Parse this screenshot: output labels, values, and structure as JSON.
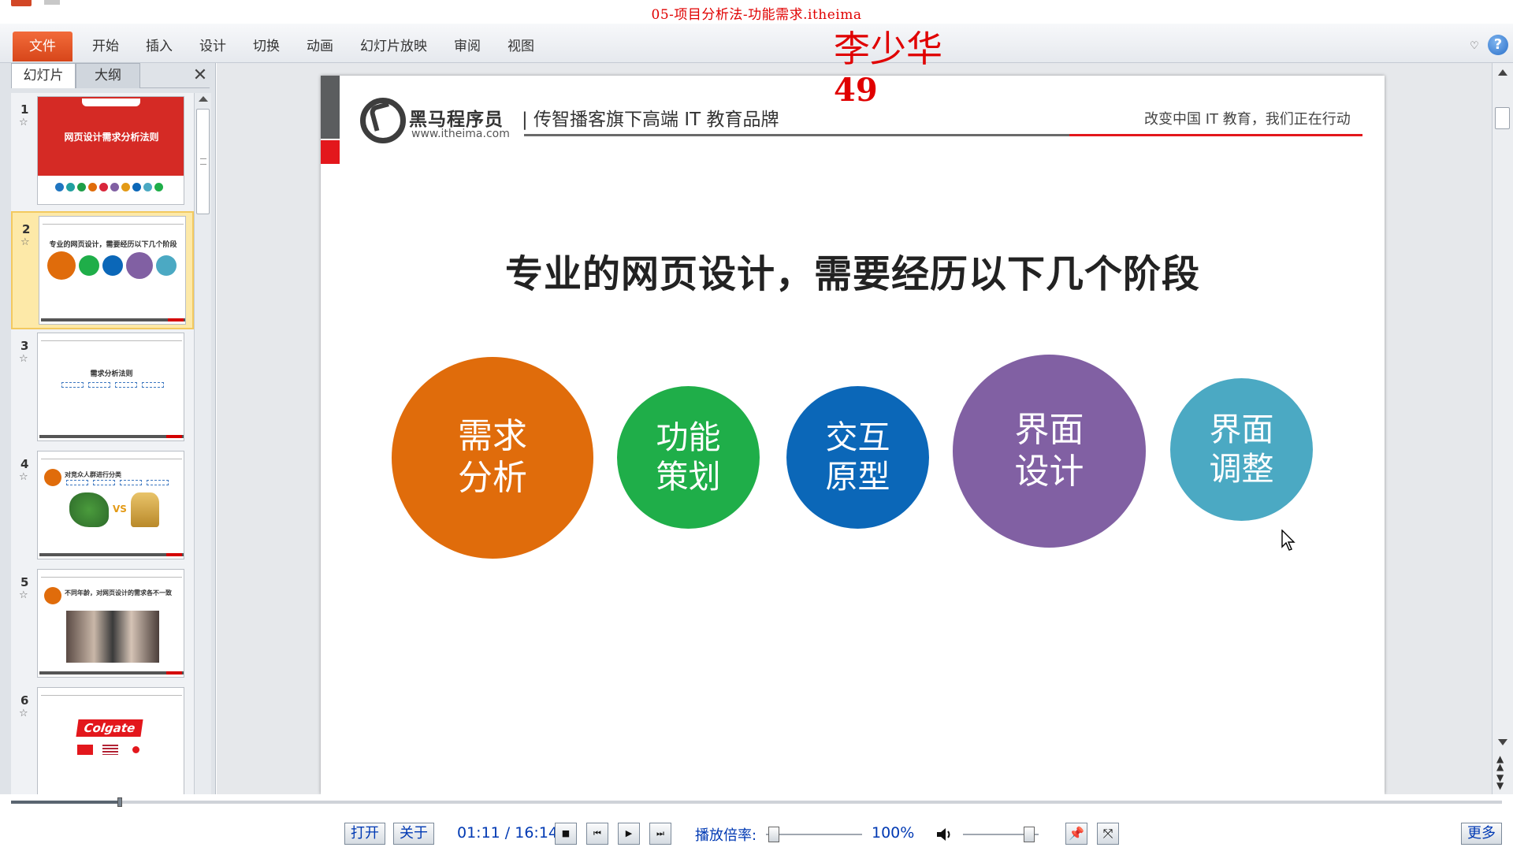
{
  "window": {
    "title": "05-项目分析法-功能需求.itheima"
  },
  "ribbon": {
    "file_tab": "文件",
    "tabs": [
      "开始",
      "插入",
      "设计",
      "切换",
      "动画",
      "幻灯片放映",
      "审阅",
      "视图"
    ]
  },
  "overlay": {
    "name": "李少华",
    "number": "49"
  },
  "left_pane": {
    "tabs": [
      "幻灯片",
      "大纲"
    ],
    "close": "✕",
    "slides": [
      {
        "num": "1",
        "title": "网页设计需求分析法则"
      },
      {
        "num": "2",
        "title": "专业的网页设计，需要经历以下几个阶段"
      },
      {
        "num": "3",
        "title": "需求分析法则"
      },
      {
        "num": "4",
        "title": "对竞众人群进行分类"
      },
      {
        "num": "5",
        "title": "不同年龄，对网页设计的需求各不一致"
      },
      {
        "num": "6",
        "title": "Colgate"
      }
    ],
    "selected_index": 1
  },
  "slide": {
    "logo_name": "黑马程序员",
    "logo_url": "www.itheima.com",
    "slogan": "| 传智播客旗下高端 IT 教育品牌",
    "slogan_right": "改变中国 IT 教育，我们正在行动",
    "heading": "专业的网页设计，需要经历以下几个阶段",
    "stages": [
      {
        "line1": "需求",
        "line2": "分析",
        "color": "#e06c0b"
      },
      {
        "line1": "功能",
        "line2": "策划",
        "color": "#1fae49"
      },
      {
        "line1": "交互",
        "line2": "原型",
        "color": "#0b67b8"
      },
      {
        "line1": "界面",
        "line2": "设计",
        "color": "#8160a3"
      },
      {
        "line1": "界面",
        "line2": "调整",
        "color": "#4ba9c3"
      }
    ]
  },
  "player": {
    "open_label": "打开",
    "about_label": "关于",
    "time": "01:11 / 16:14",
    "rate_label": "播放倍率:",
    "rate_value": "100%",
    "more_label": "更多",
    "progress_fraction": 0.073,
    "rate_fraction": 0.03,
    "volume_fraction": 0.92
  }
}
